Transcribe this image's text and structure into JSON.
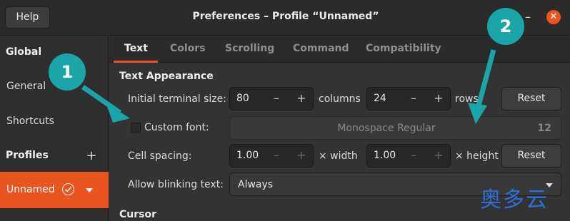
{
  "window": {
    "title": "Preferences – Profile “Unnamed”",
    "help_label": "Help",
    "minimize_glyph": "–",
    "close_glyph": "✕"
  },
  "sidebar": {
    "global_heading": "Global",
    "items": [
      {
        "label": "General"
      },
      {
        "label": "Shortcuts"
      }
    ],
    "profiles_heading": "Profiles",
    "add_glyph": "+",
    "profile": {
      "label": "Unnamed",
      "default_icon": "check-circle-icon",
      "menu_icon": "caret-down-icon"
    }
  },
  "tabs": [
    {
      "label": "Text",
      "active": true
    },
    {
      "label": "Colors",
      "active": false
    },
    {
      "label": "Scrolling",
      "active": false
    },
    {
      "label": "Command",
      "active": false
    },
    {
      "label": "Compatibility",
      "active": false
    }
  ],
  "text_appearance": {
    "heading": "Text Appearance",
    "terminal_size": {
      "label": "Initial terminal size:",
      "columns_value": "80",
      "columns_unit": "columns",
      "rows_value": "24",
      "rows_unit": "rows",
      "minus": "–",
      "plus": "+",
      "reset_label": "Reset"
    },
    "custom_font": {
      "label": "Custom font:",
      "checked": false,
      "font_name": "Monospace Regular",
      "font_size": "12"
    },
    "cell_spacing": {
      "label": "Cell spacing:",
      "width_value": "1.00",
      "width_unit": "× width",
      "height_value": "1.00",
      "height_unit": "× height",
      "reset_label": "Reset"
    },
    "blinking": {
      "label": "Allow blinking text:",
      "value": "Always"
    }
  },
  "cursor_heading": "Cursor",
  "annotations": [
    {
      "number": "1"
    },
    {
      "number": "2"
    }
  ],
  "watermark": "奥多云",
  "colors": {
    "accent": "#e95420",
    "badge": "#1aa6a8",
    "watermark": "#2d6fd8"
  }
}
